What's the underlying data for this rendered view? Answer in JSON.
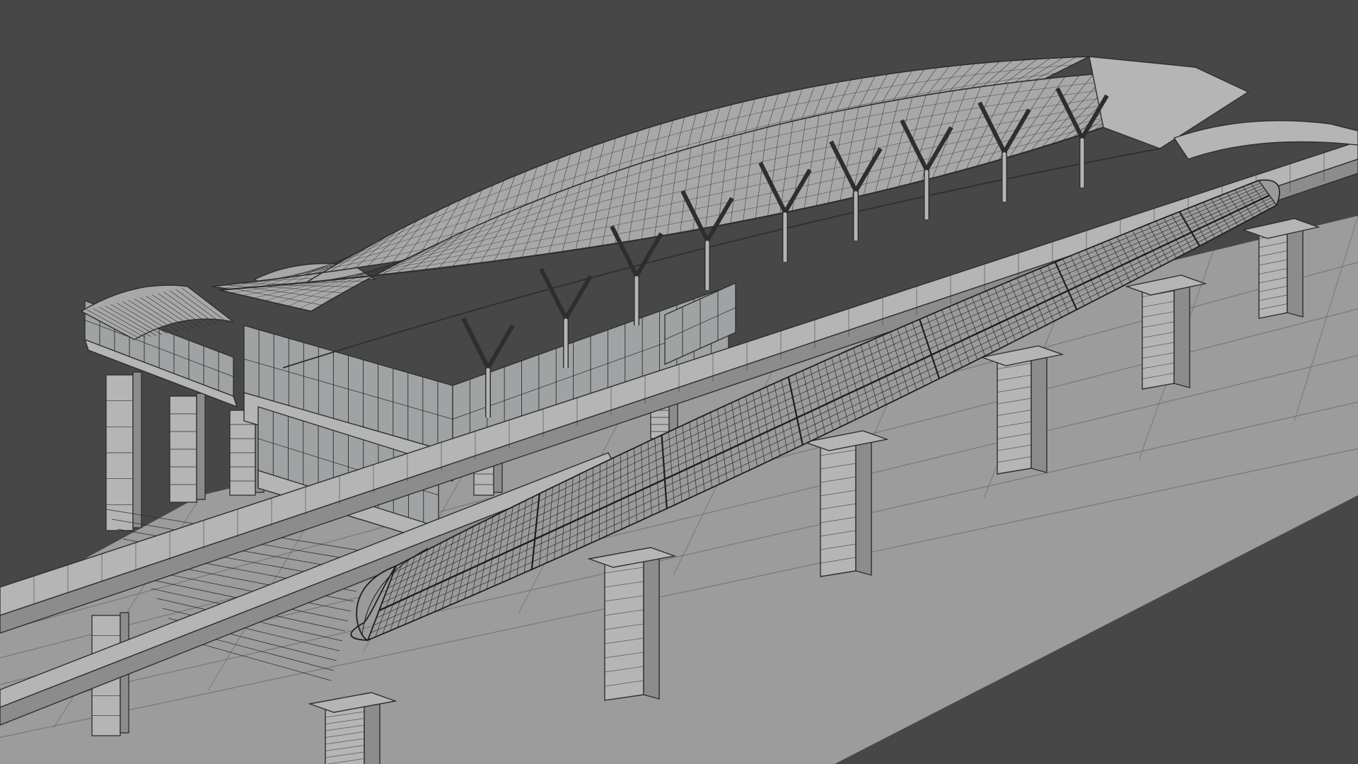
{
  "viewport": {
    "shading": "wireframe-on-shaded",
    "colors": {
      "background": "#474747",
      "ground": "#9c9c9c",
      "ground_line": "#5a5a5a",
      "structure_face": "#b5b5b5",
      "structure_dark": "#8c8c8c",
      "edge": "#2e2e2e",
      "roof_face": "#a8a8a8",
      "train_face": "#9a9a9a",
      "train_edge": "#1e1e1e",
      "glass_panel": "#9fa3a3"
    }
  },
  "scene": {
    "objects": [
      {
        "name": "ground-plane",
        "icon": "plane-icon"
      },
      {
        "name": "elevated-viaduct",
        "icon": "bridge-icon"
      },
      {
        "name": "viaduct-piers",
        "icon": "pillar-icon"
      },
      {
        "name": "station-roof",
        "icon": "roof-icon"
      },
      {
        "name": "station-platform",
        "icon": "platform-icon"
      },
      {
        "name": "bullet-train",
        "icon": "train-icon"
      }
    ]
  }
}
